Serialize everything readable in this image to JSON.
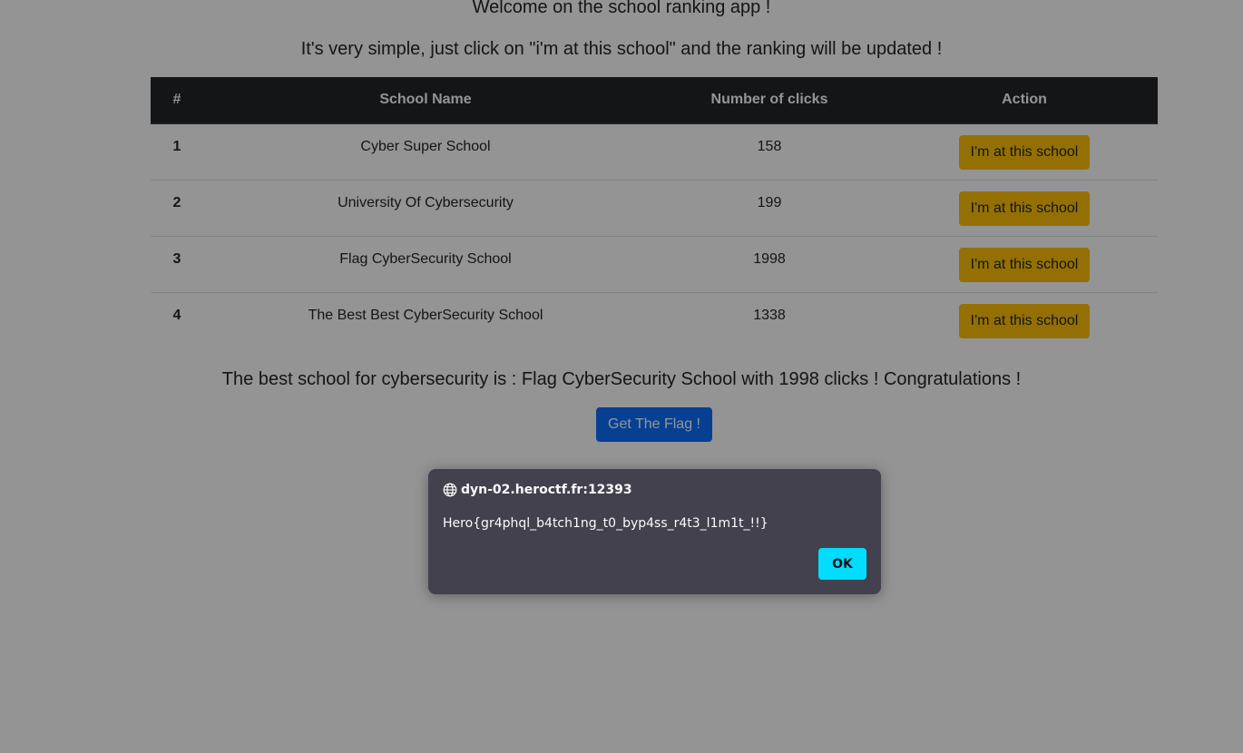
{
  "header": {
    "welcome": "Welcome on the school ranking app !",
    "instructions": "It's very simple, just click on \"i'm at this school\" and the ranking will be updated !"
  },
  "table": {
    "columns": [
      "#",
      "School Name",
      "Number of clicks",
      "Action"
    ],
    "rows": [
      {
        "rank": "1",
        "name": "Cyber Super School",
        "clicks": "158",
        "action": "I'm at this school"
      },
      {
        "rank": "2",
        "name": "University Of Cybersecurity",
        "clicks": "199",
        "action": "I'm at this school"
      },
      {
        "rank": "3",
        "name": "Flag CyberSecurity School",
        "clicks": "1998",
        "action": "I'm at this school"
      },
      {
        "rank": "4",
        "name": "The Best Best CyberSecurity School",
        "clicks": "1338",
        "action": "I'm at this school"
      }
    ]
  },
  "summary": {
    "best_text": "The best school for cybersecurity is : Flag CyberSecurity School with 1998 clicks ! Congratulations !",
    "flag_button": "Get The Flag !"
  },
  "dialog": {
    "origin": "dyn-02.heroctf.fr:12393",
    "message": "Hero{gr4phql_b4tch1ng_t0_byp4ss_r4t3_l1m1t_!!}",
    "ok_label": "OK",
    "icon": "globe-icon"
  },
  "colors": {
    "table_header": "#212529",
    "school_button": "#ffc107",
    "flag_button": "#0d6efd",
    "dialog_bg": "#42414d",
    "ok_button": "#00ddff"
  }
}
